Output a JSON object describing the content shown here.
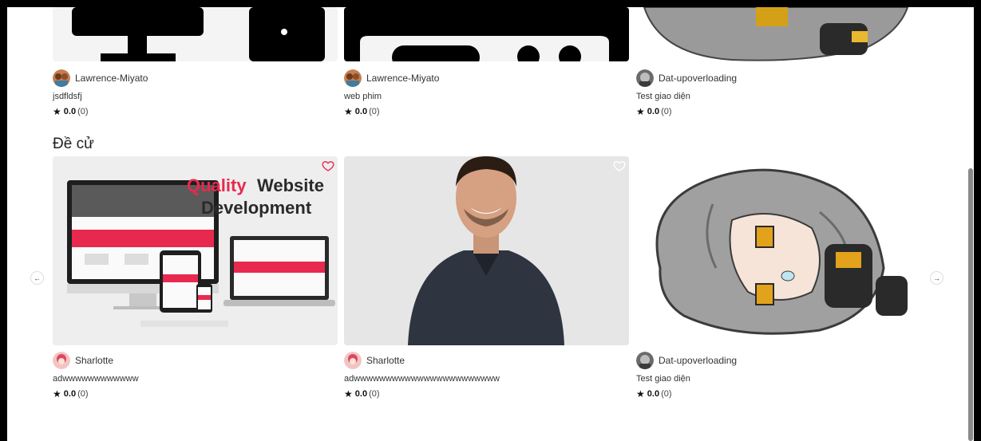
{
  "top_row": [
    {
      "author": "Lawrence-Miyato",
      "title": "jsdfldsfj",
      "rating": "0.0",
      "count": "(0)"
    },
    {
      "author": "Lawrence-Miyato",
      "title": "web phim",
      "rating": "0.0",
      "count": "(0)"
    },
    {
      "author": "Dat-upoverloading",
      "title": "Test giao diện",
      "rating": "0.0",
      "count": "(0)"
    }
  ],
  "recommended": {
    "heading": "Đề cử",
    "items": [
      {
        "author": "Sharlotte",
        "title": "adwwwwwwwwwwww",
        "rating": "0.0",
        "count": "(0)",
        "banner_line1_accent": "Quality",
        "banner_line1_rest": " Website",
        "banner_line2": "Development"
      },
      {
        "author": "Sharlotte",
        "title": "adwwwwwwwwwwwwwwwwwwwwwww",
        "rating": "0.0",
        "count": "(0)"
      },
      {
        "author": "Dat-upoverloading",
        "title": "Test giao diện",
        "rating": "0.0",
        "count": "(0)"
      }
    ]
  },
  "icons": {
    "star": "★",
    "prev": "←",
    "next": "→",
    "heart": "heart-outline-icon"
  },
  "colors": {
    "accent": "#e8294f",
    "heart_active": "#e8294f"
  }
}
